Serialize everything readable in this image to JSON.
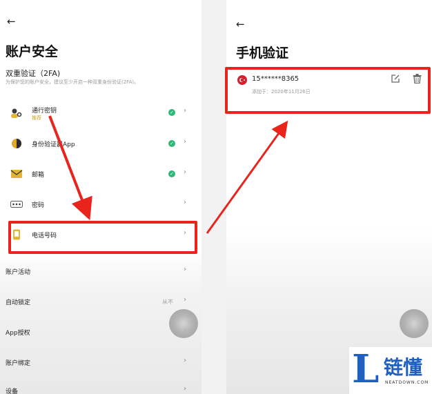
{
  "left": {
    "back_icon": "←",
    "title": "账户安全",
    "section_title": "双重验证（2FA)",
    "section_desc": "为保护您的账户安全，建议至少开启一种双重身份验证(2FA)。",
    "items": [
      {
        "label": "通行密钥",
        "sub": "推荐",
        "icon": "passkey-icon",
        "verified": true
      },
      {
        "label": "身份验证器App",
        "icon": "authenticator-icon",
        "verified": true
      },
      {
        "label": "邮箱",
        "icon": "email-icon",
        "verified": true
      },
      {
        "label": "密码",
        "icon": "password-icon",
        "verified": false
      },
      {
        "label": "电话号码",
        "icon": "phone-icon",
        "verified": false
      }
    ],
    "settings": [
      {
        "label": "账户活动",
        "value": ""
      },
      {
        "label": "自动锁定",
        "value": "从不"
      },
      {
        "label": "App授权",
        "value": ""
      },
      {
        "label": "账户绑定",
        "value": ""
      },
      {
        "label": "设备",
        "value": ""
      }
    ]
  },
  "right": {
    "back_icon": "←",
    "title": "手机验证",
    "phone": "15******8365",
    "added": "添加于：2020年11月26日",
    "flag_icon": "turkey-flag-icon"
  },
  "logo": {
    "letter": "L",
    "text": "链懂",
    "url": "NEATDOWN.COM"
  },
  "colors": {
    "highlight_red": "#e8241c",
    "check_green": "#2eb878",
    "logo_blue": "#1f5fbf"
  }
}
